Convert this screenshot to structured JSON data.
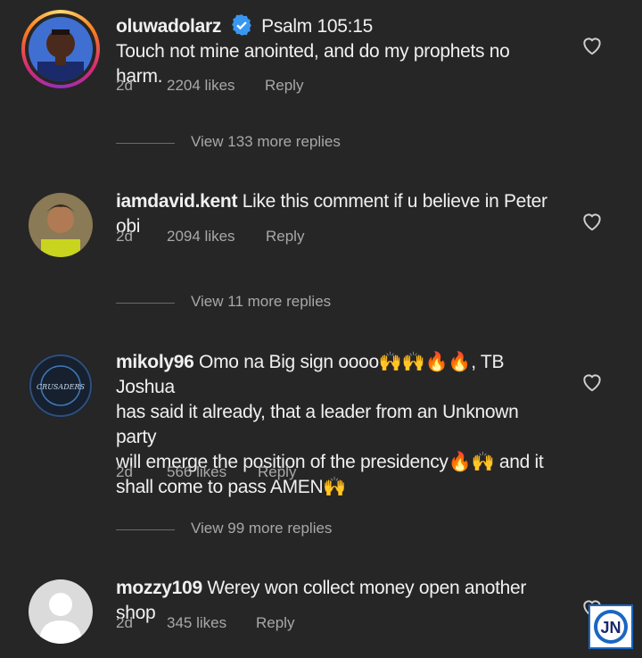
{
  "comments": [
    {
      "username": "oluwadolarz",
      "verified": true,
      "text": "Psalm 105:15\nTouch not mine anointed, and do my prophets no harm.",
      "time": "2d",
      "likes": "2204 likes",
      "reply": "Reply",
      "view_replies": "View 133 more replies"
    },
    {
      "username": "iamdavid.kent",
      "verified": false,
      "text": "Like this comment if u believe in Peter obi",
      "time": "2d",
      "likes": "2094 likes",
      "reply": "Reply",
      "view_replies": "View 11 more replies"
    },
    {
      "username": "mikoly96",
      "verified": false,
      "text_lines": [
        "Omo na Big sign oooo🙌🙌🔥🔥, TB Joshua",
        "has said it already, that a leader from an Unknown party",
        "will emerge the position of the presidency🔥🙌 and it",
        "shall come to pass AMEN🙌"
      ],
      "time": "2d",
      "likes": "566 likes",
      "reply": "Reply",
      "view_replies": "View 99 more replies",
      "avatar_text": "CRUSADERS"
    },
    {
      "username": "mozzy109",
      "verified": false,
      "text": "Werey won collect money open another shop",
      "time": "2d",
      "likes": "345 likes",
      "reply": "Reply"
    }
  ],
  "watermark": "JN",
  "colors": {
    "background": "#262626",
    "text": "#f0f0f0",
    "secondary": "#a8a8a8",
    "verified": "#3897f0"
  }
}
